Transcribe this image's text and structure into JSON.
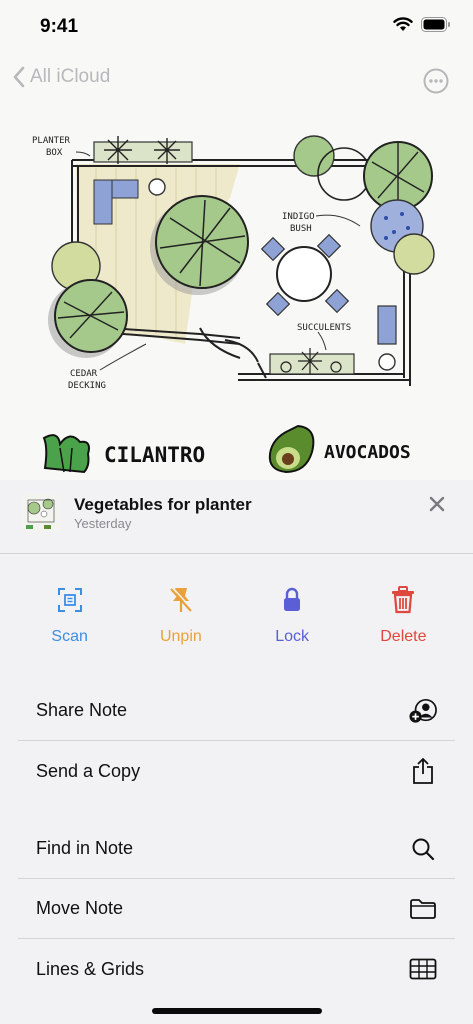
{
  "status": {
    "time": "9:41"
  },
  "nav": {
    "back_label": "All iCloud"
  },
  "note": {
    "sketch_labels": {
      "planter_box_1": "PLANTER",
      "planter_box_2": "BOX",
      "indigo_bush_1": "INDIGO",
      "indigo_bush_2": "BUSH",
      "succulents": "SUCCULENTS",
      "cedar_decking_1": "CEDAR",
      "cedar_decking_2": "DECKING"
    },
    "cilantro": "CILANTRO",
    "avocados": "AVOCADOS"
  },
  "sheet": {
    "title": "Vegetables for planter",
    "subtitle": "Yesterday"
  },
  "actions": [
    {
      "label": "Scan",
      "icon": "scan-icon",
      "color": "#3b8ee4"
    },
    {
      "label": "Unpin",
      "icon": "unpin-icon",
      "color": "#e9a23b"
    },
    {
      "label": "Lock",
      "icon": "lock-icon",
      "color": "#5a5fd6"
    },
    {
      "label": "Delete",
      "icon": "trash-icon",
      "color": "#e0483e"
    }
  ],
  "menu_group_1": [
    {
      "label": "Share Note",
      "icon": "share-note-icon"
    },
    {
      "label": "Send a Copy",
      "icon": "send-copy-icon"
    }
  ],
  "menu_group_2": [
    {
      "label": "Find in Note",
      "icon": "magnifier-icon"
    },
    {
      "label": "Move Note",
      "icon": "folder-icon"
    },
    {
      "label": "Lines & Grids",
      "icon": "grid-icon"
    }
  ]
}
